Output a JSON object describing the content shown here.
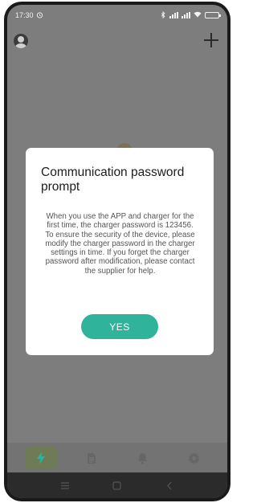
{
  "status_bar": {
    "time": "17:30"
  },
  "header": {
    "avatar_icon": "user-avatar-icon",
    "add_icon": "plus-icon"
  },
  "dialog": {
    "title": "Communication password prompt",
    "message": "When you use the APP and charger for the first time, the charger password is 123456. To ensure the security of the device, please modify the charger password in the charger settings in time. If you forget the charger password after modification, please contact the supplier for help.",
    "confirm_label": "YES",
    "accent_color": "#2fb39a"
  },
  "tab_bar": {
    "tabs": [
      {
        "icon": "lightning-icon",
        "active": true
      },
      {
        "icon": "document-icon",
        "active": false
      },
      {
        "icon": "bell-icon",
        "active": false
      },
      {
        "icon": "gear-icon",
        "active": false
      }
    ]
  },
  "system_nav": {
    "buttons": [
      "menu-icon",
      "home-icon",
      "back-icon"
    ]
  }
}
